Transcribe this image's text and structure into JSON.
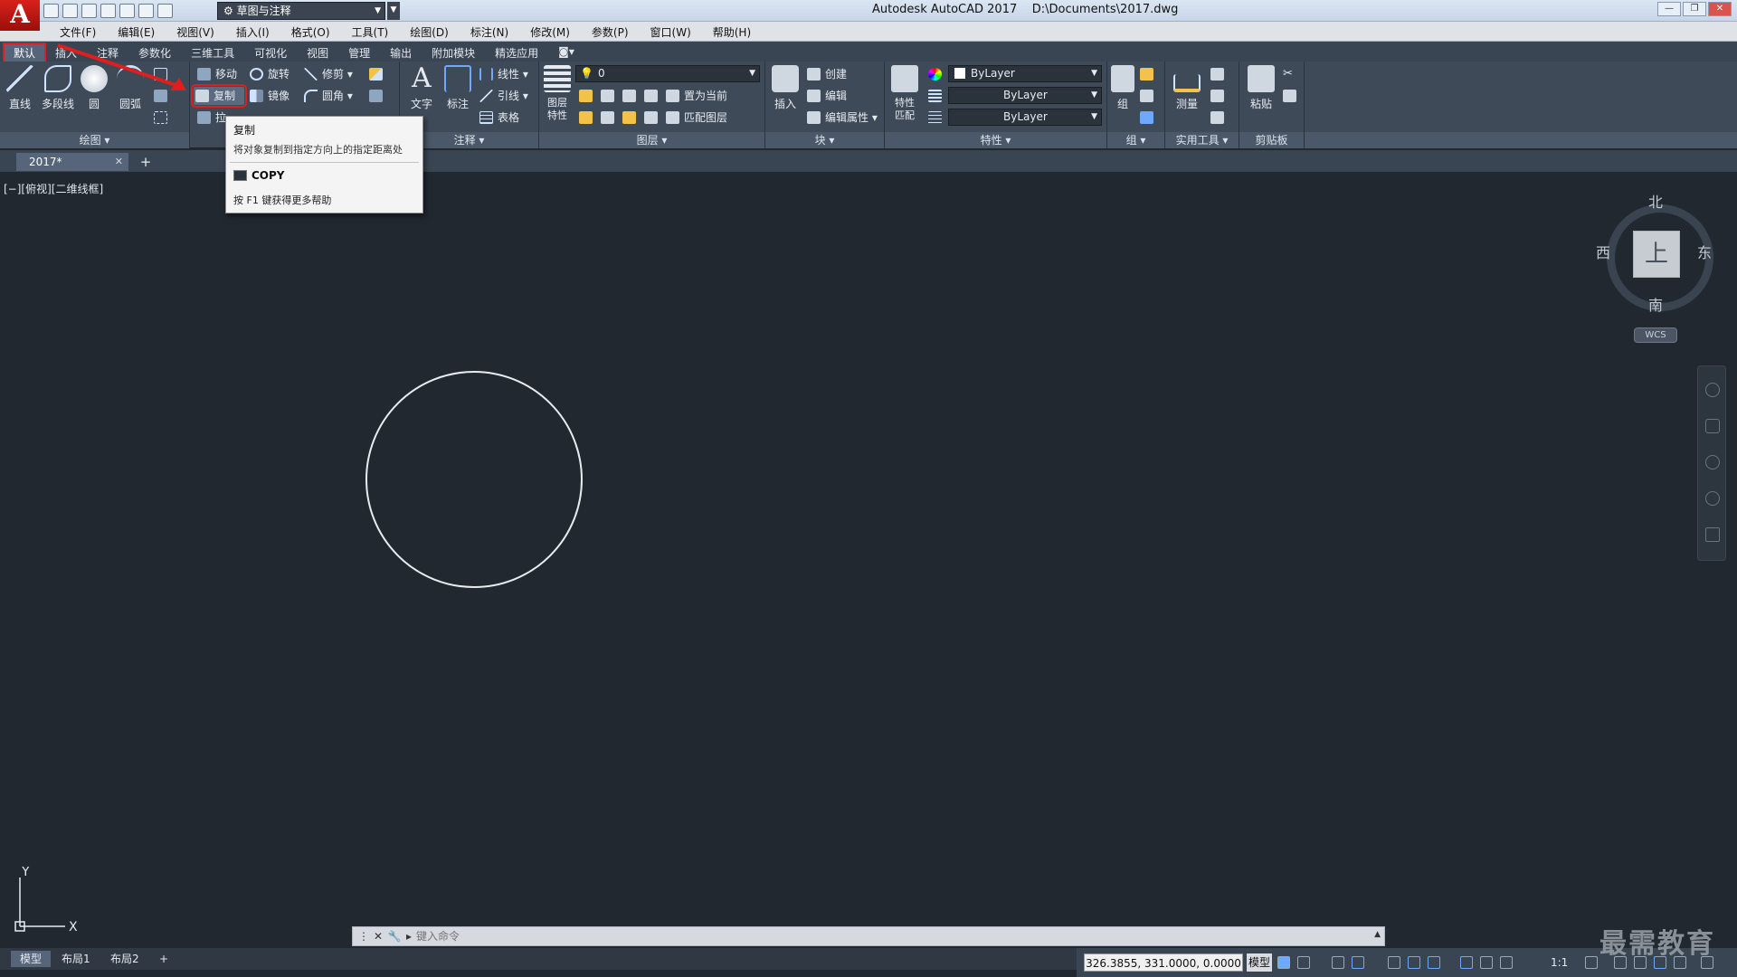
{
  "titlebar": {
    "workspace": "草图与注释",
    "app_title": "Autodesk AutoCAD 2017",
    "file_path": "D:\\Documents\\2017.dwg"
  },
  "menubar": {
    "items": [
      "文件(F)",
      "编辑(E)",
      "视图(V)",
      "插入(I)",
      "格式(O)",
      "工具(T)",
      "绘图(D)",
      "标注(N)",
      "修改(M)",
      "参数(P)",
      "窗口(W)",
      "帮助(H)"
    ]
  },
  "ribbon_tabs": [
    "默认",
    "插入",
    "注释",
    "参数化",
    "三维工具",
    "可视化",
    "视图",
    "管理",
    "输出",
    "附加模块",
    "精选应用"
  ],
  "ribbon": {
    "draw": {
      "title": "绘图",
      "line": "直线",
      "polyline": "多段线",
      "circle": "圆",
      "arc": "圆弧"
    },
    "modify": {
      "move": "移动",
      "rotate": "旋转",
      "trim": "修剪",
      "copy": "复制",
      "mirror": "镜像",
      "fillet": "圆角",
      "stretch": "拉"
    },
    "annotation": {
      "title": "注释",
      "text": "文字",
      "dimension": "标注",
      "linear": "线性",
      "leader": "引线",
      "table": "表格"
    },
    "layers": {
      "title": "图层",
      "properties": "图层\n特性",
      "current_layer": "0",
      "set_current": "置为当前",
      "match_layer": "匹配图层"
    },
    "block": {
      "title": "块",
      "insert": "插入",
      "create": "创建",
      "edit": "编辑",
      "edit_attributes": "编辑属性"
    },
    "properties": {
      "title": "特性",
      "match": "特性\n匹配",
      "color": "ByLayer",
      "linetype": "ByLayer",
      "lineweight": "ByLayer"
    },
    "groups": {
      "title": "组",
      "group": "组"
    },
    "utilities": {
      "title": "实用工具",
      "measure": "测量"
    },
    "clipboard": {
      "title": "剪贴板",
      "paste": "粘贴"
    }
  },
  "tooltip": {
    "title": "复制",
    "description": "将对象复制到指定方向上的指定距离处",
    "command": "COPY",
    "help": "按 F1 键获得更多帮助"
  },
  "file_tab": {
    "name": "2017*"
  },
  "viewport": {
    "label": "[−][俯视][二维线框]"
  },
  "viewcube": {
    "north": "北",
    "south": "南",
    "east": "东",
    "west": "西",
    "face": "上",
    "wcs": "WCS"
  },
  "ucs": {
    "x": "X",
    "y": "Y"
  },
  "command_line": {
    "placeholder": "键入命令"
  },
  "layout_tabs": [
    "模型",
    "布局1",
    "布局2"
  ],
  "statusbar": {
    "coords": "326.3855, 331.0000, 0.0000",
    "model": "模型",
    "scale": "1:1"
  },
  "watermark": "最需教育",
  "colors": {
    "canvas": "#212830",
    "ribbon": "#3f4a58",
    "highlight": "#e01e1e"
  }
}
